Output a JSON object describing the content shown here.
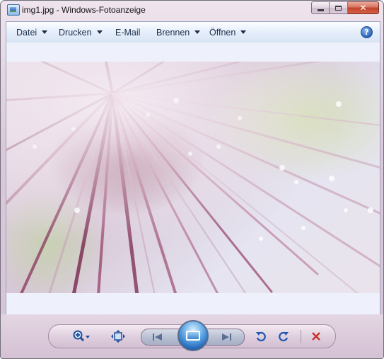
{
  "window": {
    "title": "img1.jpg - Windows-Fotoanzeige",
    "controls": {
      "minimize": "minimize",
      "maximize": "maximize",
      "close": "close"
    }
  },
  "menubar": {
    "items": [
      {
        "label": "Datei",
        "has_dropdown": true
      },
      {
        "label": "Drucken",
        "has_dropdown": true
      },
      {
        "label": "E-Mail",
        "has_dropdown": false
      },
      {
        "label": "Brennen",
        "has_dropdown": true
      },
      {
        "label": "Öffnen",
        "has_dropdown": true
      }
    ],
    "help_glyph": "?"
  },
  "toolbar": {
    "icons": [
      "zoom-icon",
      "fit-to-window-icon",
      "previous-icon",
      "slideshow-icon",
      "next-icon",
      "rotate-left-icon",
      "rotate-right-icon",
      "delete-icon"
    ]
  },
  "colors": {
    "frame": "#ddc8db",
    "client_bg": "#eef1fb",
    "accent_blue": "#2a64b8",
    "delete_red": "#c8312a"
  }
}
